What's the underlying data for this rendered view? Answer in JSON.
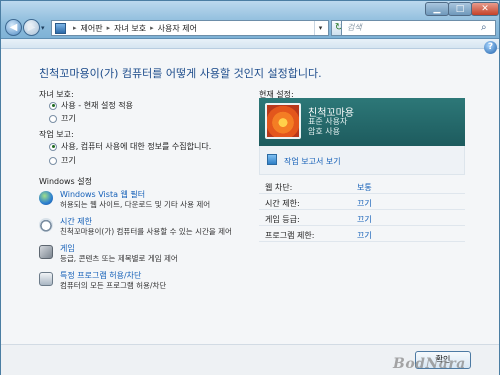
{
  "titlebar": {
    "min_glyph": "▁",
    "max_glyph": "□",
    "close_glyph": "✕"
  },
  "nav": {
    "back_glyph": "◀",
    "forward_glyph": "▶",
    "dropdown_glyph": "▾"
  },
  "address": {
    "crumbs": [
      "제어판",
      "자녀 보호",
      "사용자 제어"
    ],
    "separator": "▸",
    "dropdown_glyph": "▾",
    "refresh_glyph": "↻"
  },
  "search": {
    "placeholder": "검색",
    "icon_glyph": "⌕"
  },
  "help_glyph": "?",
  "main": {
    "heading": "친척꼬마용이(가) 컴퓨터를 어떻게 사용할 것인지 설정합니다.",
    "parental_controls": {
      "label": "자녀 보호:",
      "options": [
        "사용 - 현재 설정 적용",
        "끄기"
      ],
      "selected": 0
    },
    "activity_reporting": {
      "label": "작업 보고:",
      "options": [
        "사용, 컴퓨터 사용에 대한 정보를 수집합니다.",
        "끄기"
      ],
      "selected": 0
    },
    "windows_settings": {
      "label": "Windows 설정",
      "items": [
        {
          "title": "Windows Vista 웹 필터",
          "desc": "허용되는 웹 사이트, 다운로드 및 기타 사용 제어",
          "icon": "globe-icon"
        },
        {
          "title": "시간 제한",
          "desc": "친척꼬마용이(가) 컴퓨터를 사용할 수 있는 시간을 제어",
          "icon": "clock-icon"
        },
        {
          "title": "게임",
          "desc": "등급, 콘텐츠 또는 제목별로 게임 제어",
          "icon": "game-icon"
        },
        {
          "title": "특정 프로그램 허용/차단",
          "desc": "컴퓨터의 모든 프로그램 허용/차단",
          "icon": "program-icon"
        }
      ]
    }
  },
  "current_settings": {
    "label": "현재 설정:",
    "user_name": "친척꼬마용",
    "user_type": "표준 사용자",
    "password": "암호 사용",
    "report_link": "작업 보고서 보기",
    "rows": [
      {
        "label": "웹 차단:",
        "value": "보통"
      },
      {
        "label": "시간 제한:",
        "value": "끄기"
      },
      {
        "label": "게임 등급:",
        "value": "끄기"
      },
      {
        "label": "프로그램 제한:",
        "value": "끄기"
      }
    ]
  },
  "footer": {
    "ok_label": "확인"
  },
  "watermark": "BodNara",
  "colors": {
    "link": "#1560b8",
    "heading": "#1e4d8c",
    "user_tile": "#2d7878"
  }
}
